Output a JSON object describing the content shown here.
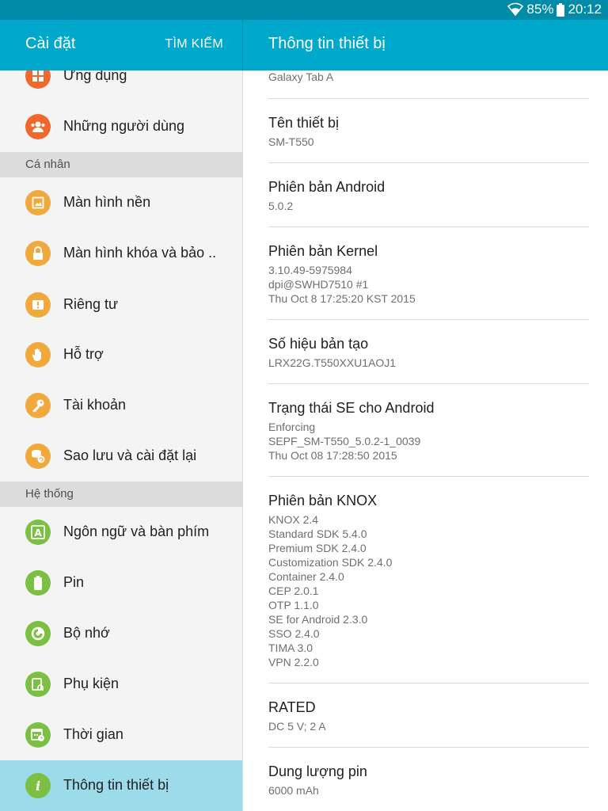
{
  "status_bar": {
    "battery": "85%",
    "time": "20:12"
  },
  "left_header": {
    "title": "Cài đặt",
    "search": "TÌM KIẾM"
  },
  "right_header": {
    "title": "Thông tin thiết bị"
  },
  "menu": {
    "apps": "Ứng dụng",
    "users": "Những người dùng",
    "section_personal": "Cá nhân",
    "wallpaper": "Màn hình nền",
    "lockscreen": "Màn hình khóa và bảo ..",
    "privacy": "Riêng tư",
    "accessibility": "Hỗ trợ",
    "accounts": "Tài khoản",
    "backup": "Sao lưu và cài đặt lại",
    "section_system": "Hệ thống",
    "language": "Ngôn ngữ và bàn phím",
    "battery": "Pin",
    "storage": "Bộ nhớ",
    "accessories": "Phụ kiện",
    "datetime": "Thời gian",
    "about": "Thông tin thiết bị"
  },
  "colors": {
    "header": "#00a8cc",
    "status": "#008ba9",
    "orange": "#f0682c",
    "yellow": "#f2a93c",
    "green": "#7bc043",
    "active_bg": "#9cdbe9"
  },
  "info": {
    "model_value": "Galaxy Tab A",
    "device_name": {
      "title": "Tên thiết bị",
      "value": "SM-T550"
    },
    "android_version": {
      "title": "Phiên bản Android",
      "value": "5.0.2"
    },
    "kernel": {
      "title": "Phiên bản Kernel",
      "value": "3.10.49-5975984\ndpi@SWHD7510 #1\nThu Oct 8 17:25:20 KST 2015"
    },
    "build": {
      "title": "Số hiệu bản tạo",
      "value": "LRX22G.T550XXU1AOJ1"
    },
    "se_status": {
      "title": "Trạng thái SE cho Android",
      "value": "Enforcing\nSEPF_SM-T550_5.0.2-1_0039\nThu Oct 08 17:28:50 2015"
    },
    "knox": {
      "title": "Phiên bản KNOX",
      "value": "KNOX 2.4\nStandard SDK 5.4.0\nPremium SDK 2.4.0\nCustomization SDK 2.4.0\nContainer 2.4.0\nCEP 2.0.1\nOTP 1.1.0\nSE for Android 2.3.0\nSSO 2.4.0\nTIMA 3.0\nVPN 2.2.0"
    },
    "rated": {
      "title": "RATED",
      "value": "DC 5 V; 2 A"
    },
    "battery_capacity": {
      "title": "Dung lượng pin",
      "value": "6000 mAh"
    }
  }
}
